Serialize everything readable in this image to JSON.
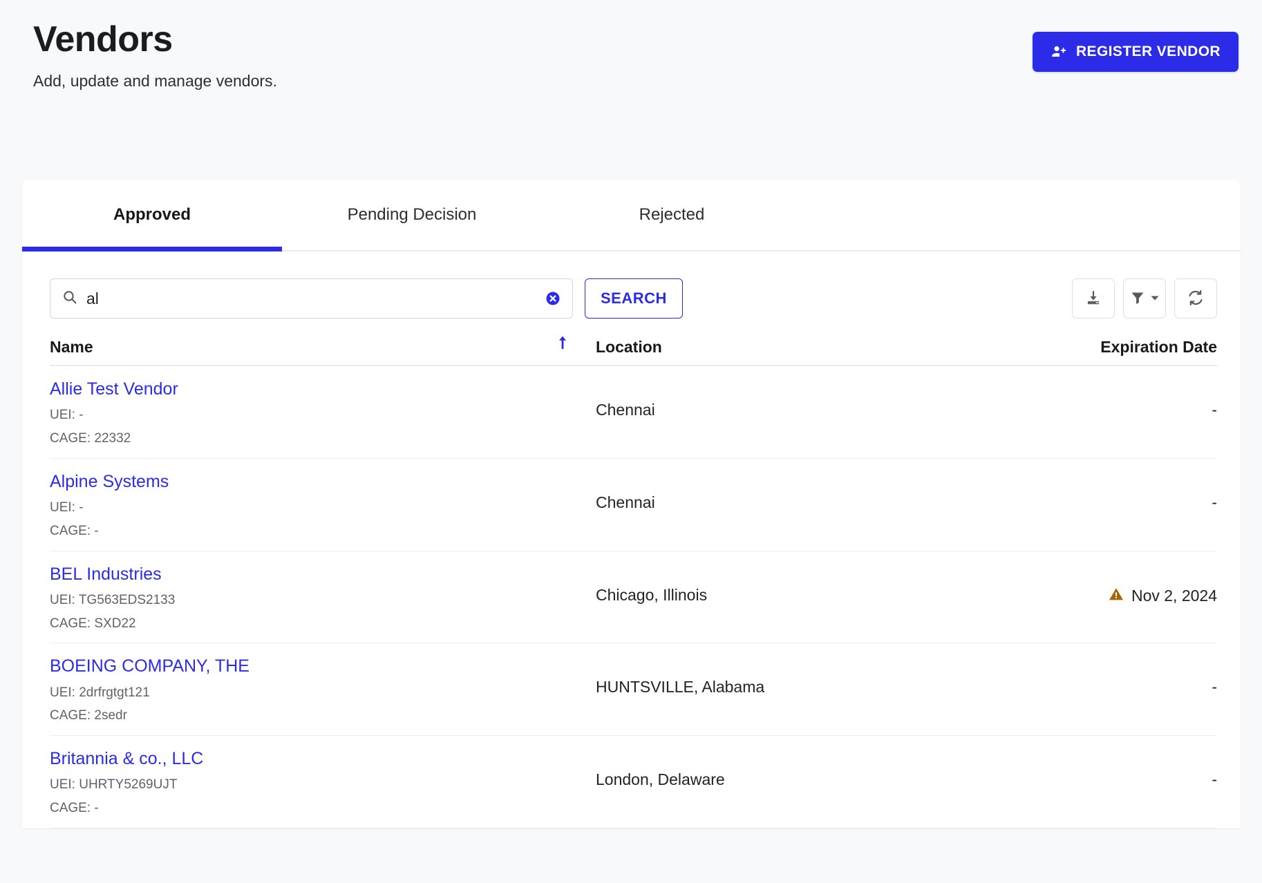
{
  "header": {
    "title": "Vendors",
    "subtitle": "Add, update and manage vendors.",
    "register_button": "REGISTER VENDOR",
    "register_icon": "person-add-icon",
    "accent_color": "#2b2be8"
  },
  "tabs": [
    {
      "label": "Approved",
      "active": true
    },
    {
      "label": "Pending Decision",
      "active": false
    },
    {
      "label": "Rejected",
      "active": false
    }
  ],
  "toolbar": {
    "search_value": "al",
    "search_placeholder": "Search",
    "search_icon": "search-icon",
    "clear_icon": "clear-circle-icon",
    "search_button": "SEARCH",
    "export_icon": "download-icon",
    "filter_icon": "filter-funnel-icon",
    "filter_chevron_icon": "chevron-down-icon",
    "refresh_icon": "refresh-icon"
  },
  "table": {
    "columns": {
      "name": "Name",
      "location": "Location",
      "expiration": "Expiration Date"
    },
    "sort": {
      "column": "Name",
      "direction": "ascending",
      "icon": "arrow-up-icon",
      "color": "#2b2be8"
    },
    "labels": {
      "uei": "UEI:",
      "cage": "CAGE:"
    },
    "warning_icon": "warning-triangle-icon",
    "warning_color": "#a86508",
    "rows": [
      {
        "name": "Allie Test Vendor",
        "uei": "-",
        "cage": "22332",
        "location": "Chennai",
        "expiration": "-",
        "expiring_soon": false
      },
      {
        "name": "Alpine Systems",
        "uei": "-",
        "cage": "-",
        "location": "Chennai",
        "expiration": "-",
        "expiring_soon": false
      },
      {
        "name": "BEL Industries",
        "uei": "TG563EDS2133",
        "cage": "SXD22",
        "location": "Chicago, Illinois",
        "expiration": "Nov 2, 2024",
        "expiring_soon": true
      },
      {
        "name": "BOEING COMPANY, THE",
        "uei": "2drfrgtgt121",
        "cage": "2sedr",
        "location": "HUNTSVILLE, Alabama",
        "expiration": "-",
        "expiring_soon": false
      },
      {
        "name": "Britannia & co., LLC",
        "uei": "UHRTY5269UJT",
        "cage": "-",
        "location": "London, Delaware",
        "expiration": "-",
        "expiring_soon": false
      }
    ]
  }
}
